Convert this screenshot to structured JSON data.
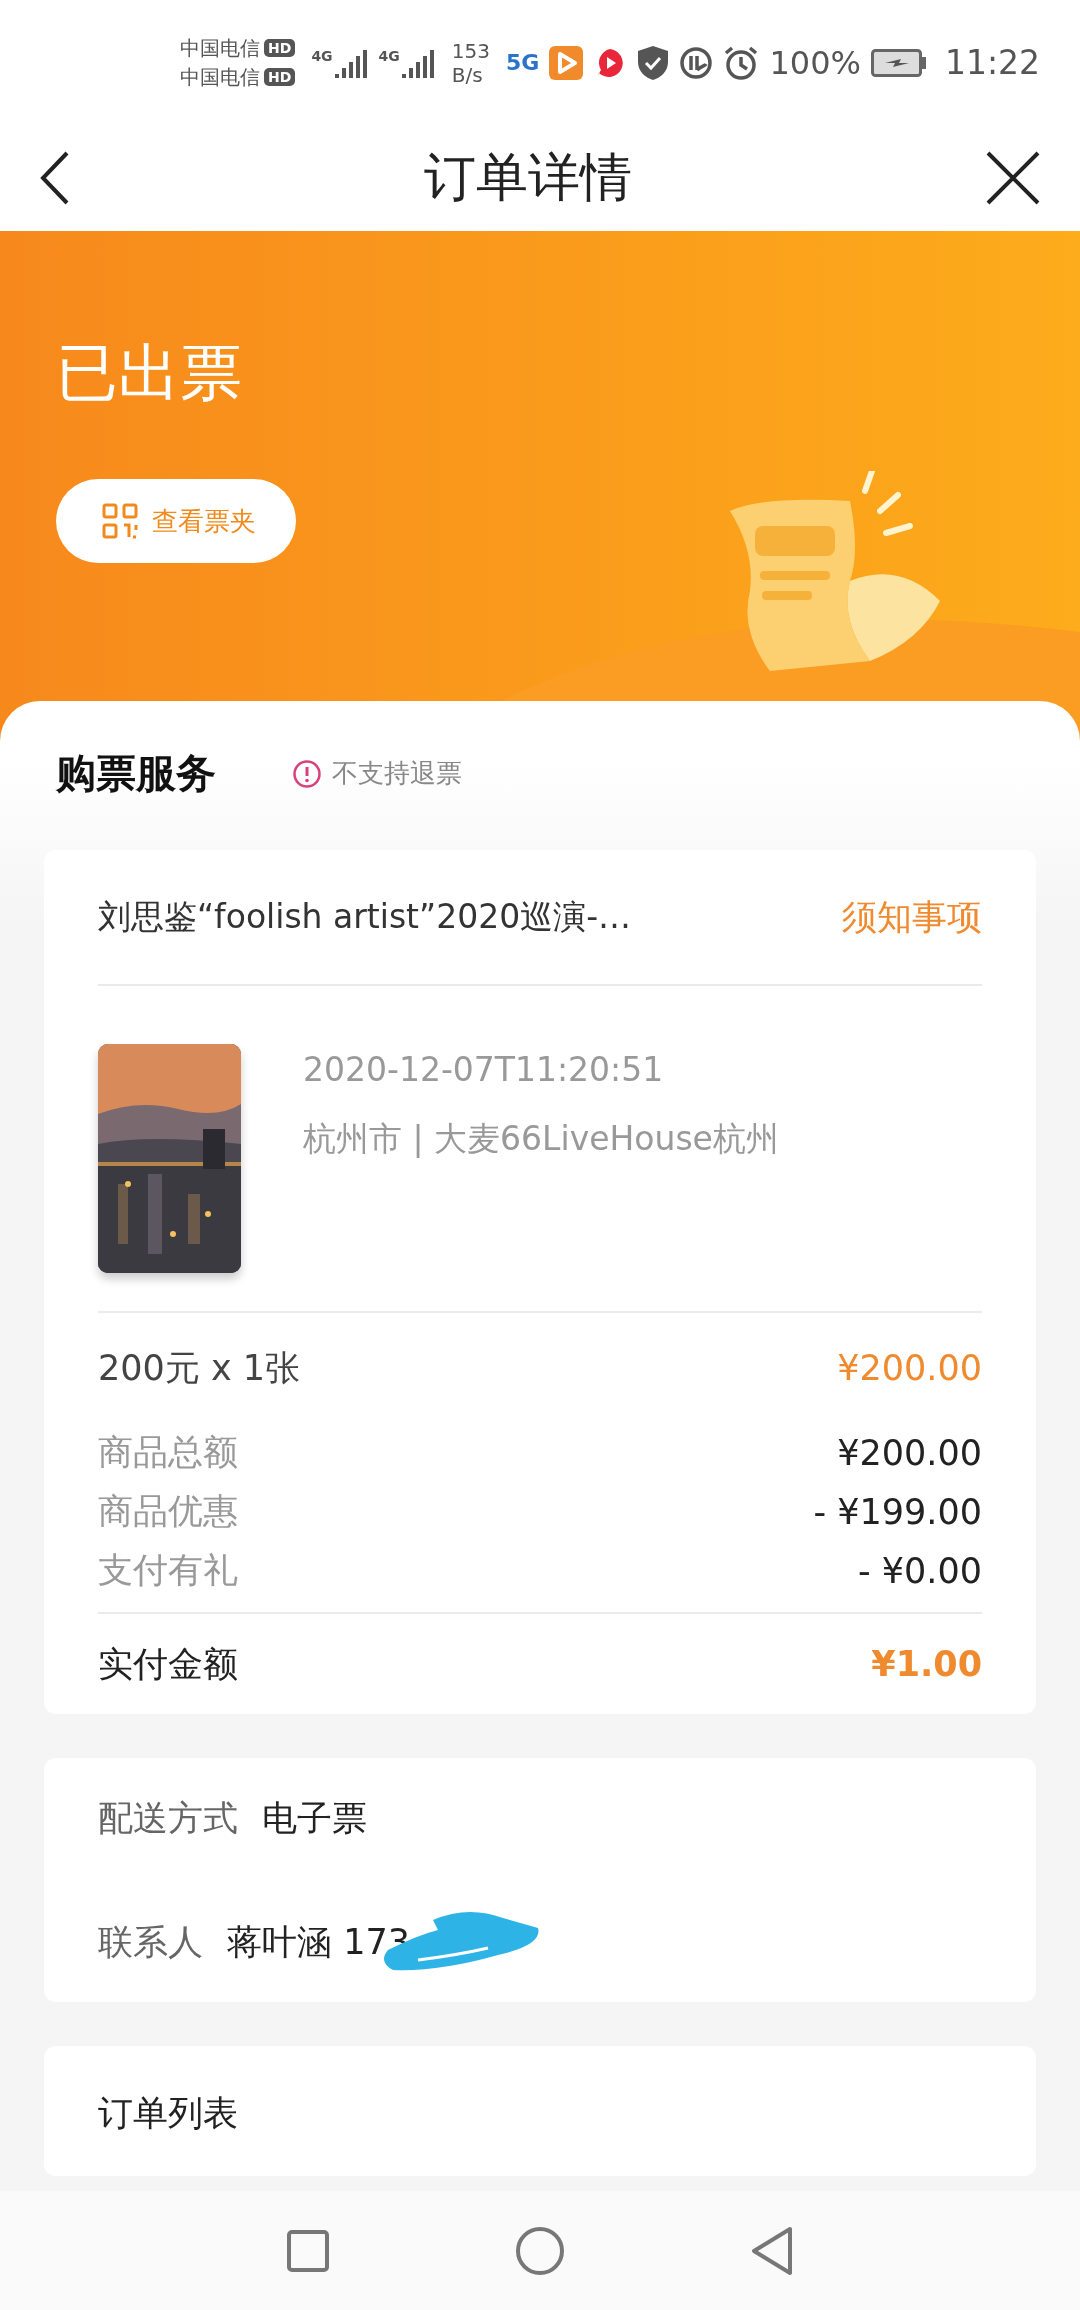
{
  "status_bar": {
    "carriers": [
      {
        "name": "中国电信",
        "badge": "HD",
        "network": "4G"
      },
      {
        "name": "中国电信",
        "badge": "HD",
        "network": "4G"
      }
    ],
    "speed_value": "153",
    "speed_unit": "B/s",
    "logo_text": "5G",
    "battery": "100%",
    "time": "11:22"
  },
  "nav_bar": {
    "title": "订单详情"
  },
  "banner": {
    "status": "已出票",
    "button": "查看票夹"
  },
  "service": {
    "title": "购票服务",
    "notice": "不支持退票"
  },
  "order": {
    "title": "刘思鉴“foolish artist”2020巡演-…",
    "notice_link": "须知事项",
    "datetime": "2020-12-07T11:20:51",
    "venue": "杭州市 | 大麦66LiveHouse杭州",
    "ticket_line": "200元 x 1张",
    "ticket_price": "¥200.00",
    "summary": [
      {
        "label": "商品总额",
        "value": "¥200.00"
      },
      {
        "label": "商品优惠",
        "value": "- ¥199.00"
      },
      {
        "label": "支付有礼",
        "value": "- ¥0.00"
      }
    ],
    "total": {
      "label": "实付金额",
      "value": "¥1.00"
    }
  },
  "delivery": {
    "label": "配送方式",
    "value": "电子票"
  },
  "contact": {
    "label": "联系人",
    "value": "蒋叶涵 173"
  },
  "order_list": {
    "title": "订单列表"
  }
}
